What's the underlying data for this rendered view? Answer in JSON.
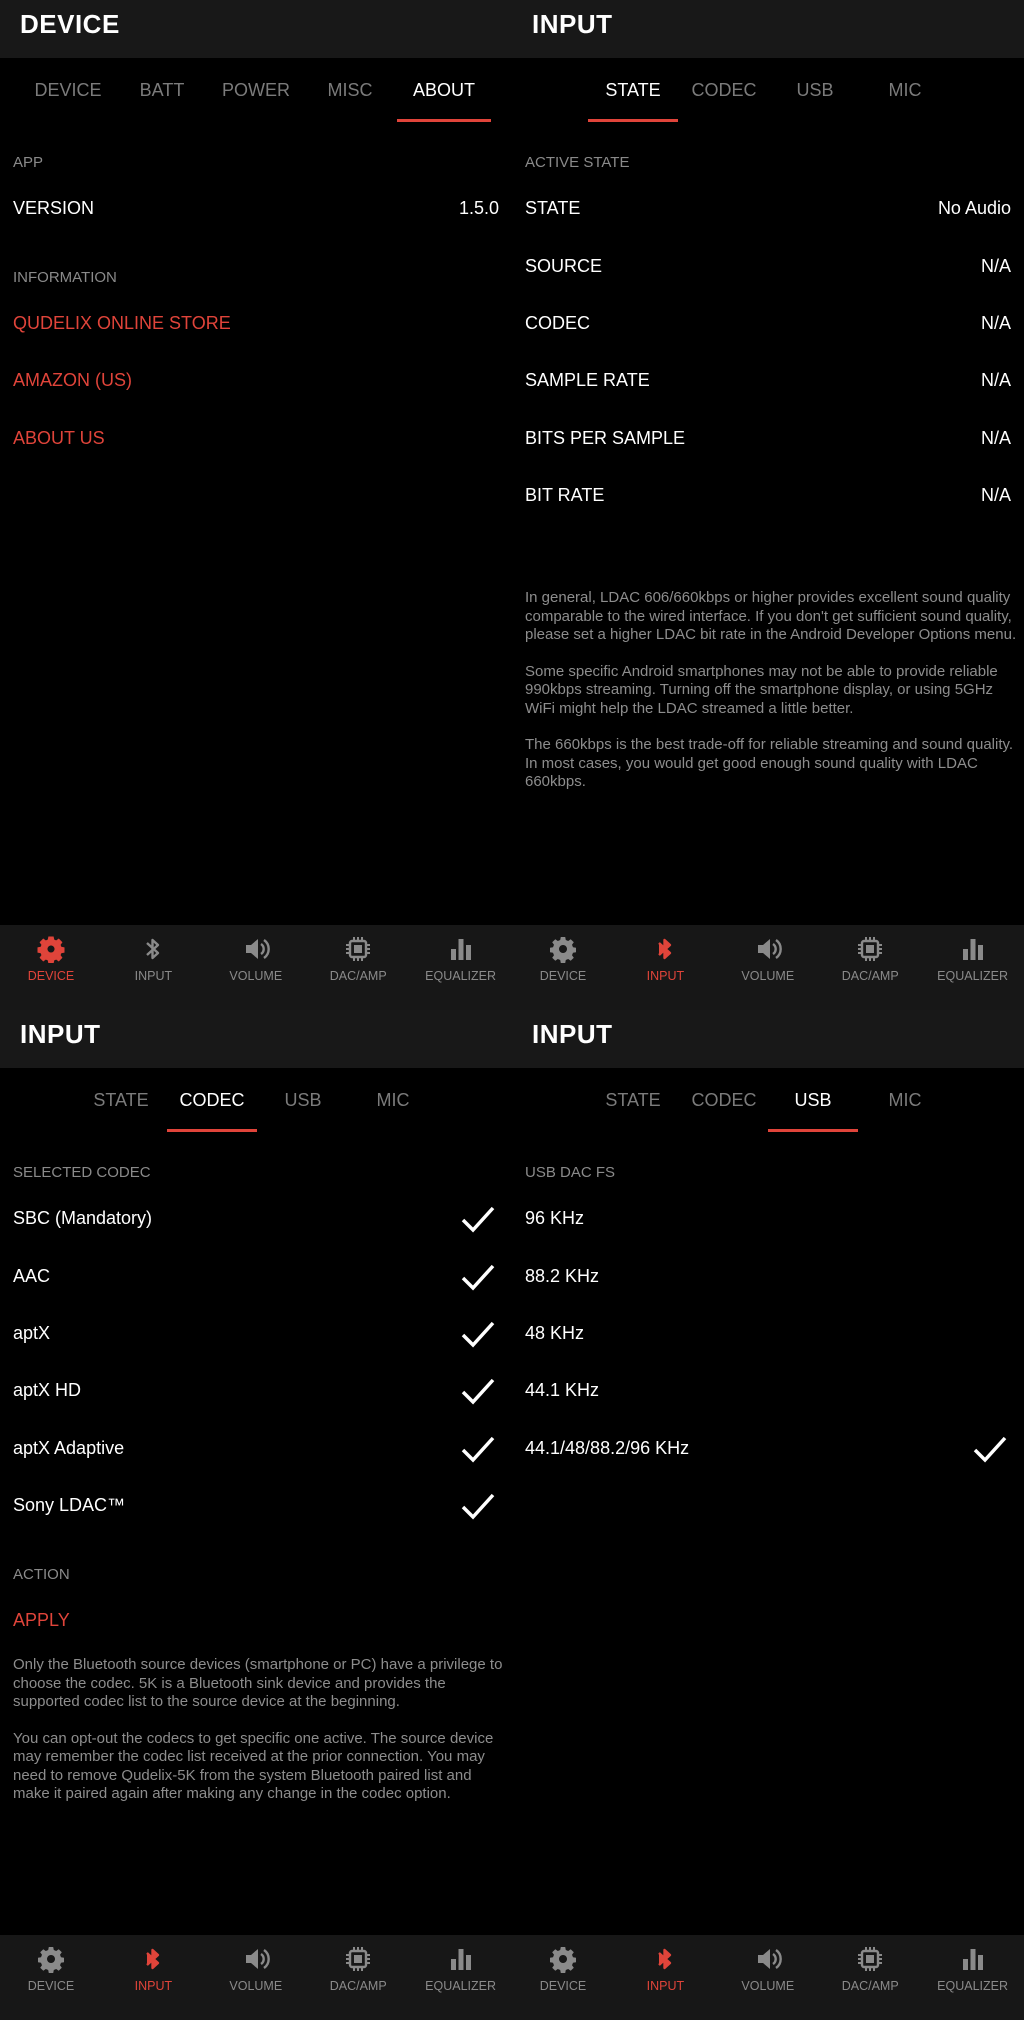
{
  "panels": {
    "device_about": {
      "title": "DEVICE",
      "tabs": [
        "DEVICE",
        "BATT",
        "POWER",
        "MISC",
        "ABOUT"
      ],
      "active_tab": "ABOUT",
      "app_section": "APP",
      "version_label": "VERSION",
      "version_value": "1.5.0",
      "info_section": "INFORMATION",
      "links": [
        "QUDELIX ONLINE STORE",
        "AMAZON (US)",
        "ABOUT US"
      ]
    },
    "input_state": {
      "title": "INPUT",
      "tabs": [
        "STATE",
        "CODEC",
        "USB",
        "MIC"
      ],
      "active_tab": "STATE",
      "section": "ACTIVE STATE",
      "rows": [
        {
          "label": "STATE",
          "value": "No Audio"
        },
        {
          "label": "SOURCE",
          "value": "N/A"
        },
        {
          "label": "CODEC",
          "value": "N/A"
        },
        {
          "label": "SAMPLE RATE",
          "value": "N/A"
        },
        {
          "label": "BITS PER SAMPLE",
          "value": "N/A"
        },
        {
          "label": "BIT RATE",
          "value": "N/A"
        }
      ],
      "notes": [
        "In general, LDAC 606/660kbps or higher provides excellent sound quality comparable to the wired interface. If you don't get sufficient sound quality, please set a higher LDAC bit rate in the Android Developer Options menu.",
        "Some specific Android smartphones may not be able to provide reliable 990kbps streaming. Turning off the smartphone display, or using 5GHz WiFi might help the LDAC streamed a little better.",
        "The 660kbps is the best trade-off for reliable streaming and sound quality. In most cases, you would get good enough sound quality with LDAC 660kbps."
      ]
    },
    "input_codec": {
      "title": "INPUT",
      "tabs": [
        "STATE",
        "CODEC",
        "USB",
        "MIC"
      ],
      "active_tab": "CODEC",
      "section": "SELECTED CODEC",
      "codecs": [
        {
          "label": "SBC (Mandatory)",
          "checked": true
        },
        {
          "label": "AAC",
          "checked": true
        },
        {
          "label": "aptX",
          "checked": true
        },
        {
          "label": "aptX HD",
          "checked": true
        },
        {
          "label": "aptX Adaptive",
          "checked": true
        },
        {
          "label": "Sony LDAC™",
          "checked": true
        }
      ],
      "action_section": "ACTION",
      "apply_label": "APPLY",
      "notes": [
        "Only the Bluetooth source devices (smartphone or PC) have a privilege to choose the codec. 5K is a Bluetooth sink device and provides the supported codec list to the source device at the beginning.",
        "You can opt-out the codecs to get specific one active. The source device may remember the codec list received at the prior connection. You may need to remove Qudelix-5K from the system Bluetooth paired list and make it paired again after making any change in the codec option."
      ]
    },
    "input_usb": {
      "title": "INPUT",
      "tabs": [
        "STATE",
        "CODEC",
        "USB",
        "MIC"
      ],
      "active_tab": "USB",
      "section": "USB DAC FS",
      "options": [
        {
          "label": "96 KHz",
          "checked": false
        },
        {
          "label": "88.2 KHz",
          "checked": false
        },
        {
          "label": "48 KHz",
          "checked": false
        },
        {
          "label": "44.1 KHz",
          "checked": false
        },
        {
          "label": "44.1/48/88.2/96 KHz",
          "checked": true
        }
      ]
    }
  },
  "bottom_nav": {
    "items": [
      {
        "label": "DEVICE",
        "icon": "gear-icon"
      },
      {
        "label": "INPUT",
        "icon": "bluetooth-icon"
      },
      {
        "label": "VOLUME",
        "icon": "speaker-icon"
      },
      {
        "label": "DAC/AMP",
        "icon": "chip-icon"
      },
      {
        "label": "EQUALIZER",
        "icon": "bar-chart-icon"
      }
    ],
    "active": {
      "device_about": "DEVICE",
      "input_state": "INPUT",
      "input_codec": "INPUT",
      "input_usb": "INPUT"
    }
  },
  "colors": {
    "accent": "#e0443a",
    "background": "#000000",
    "appbar": "#181818",
    "navbar": "#171717",
    "muted": "#8a8a8a"
  }
}
